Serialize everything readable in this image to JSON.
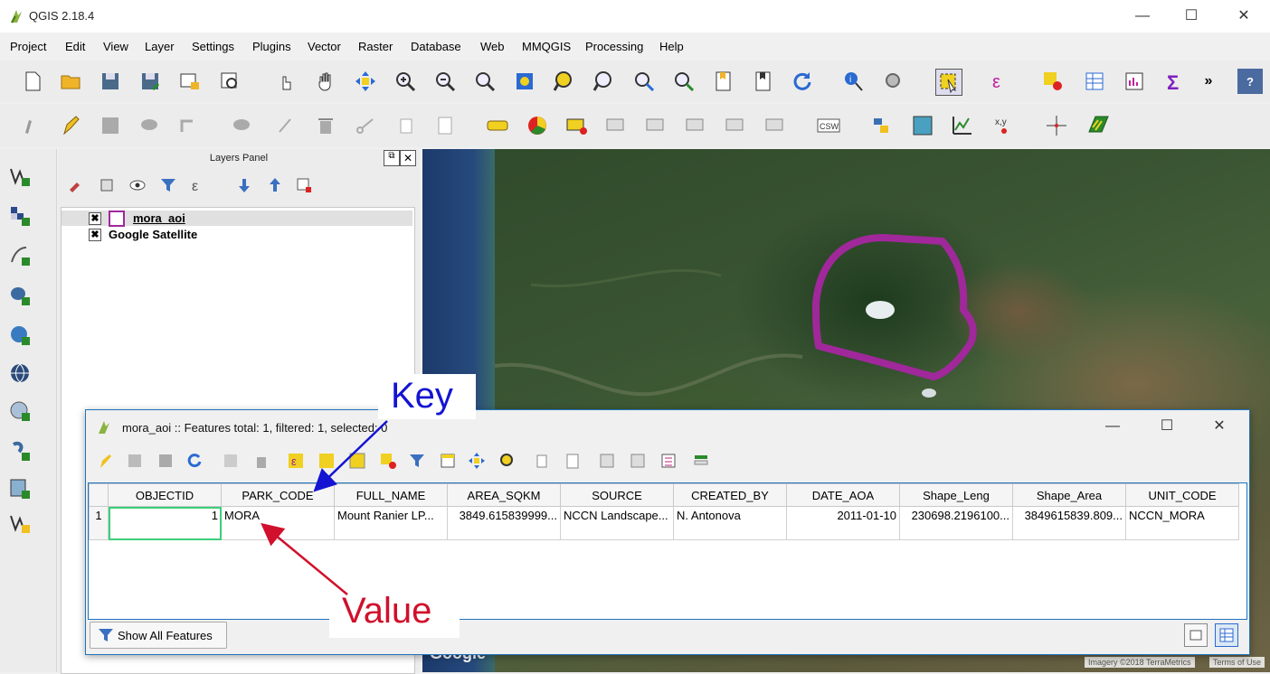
{
  "app": {
    "title": "QGIS 2.18.4"
  },
  "window_controls": {
    "minimize": "—",
    "maximize": "☐",
    "close": "✕"
  },
  "menu": [
    "Project",
    "Edit",
    "View",
    "Layer",
    "Settings",
    "Plugins",
    "Vector",
    "Raster",
    "Database",
    "Web",
    "MMQGIS",
    "Processing",
    "Help"
  ],
  "toolbar": {
    "overflow": "»",
    "help": "?"
  },
  "layers_panel": {
    "title": "Layers Panel",
    "layers": [
      {
        "name": "mora_aoi",
        "checked": "✖"
      },
      {
        "name": "Google Satellite",
        "checked": "✖"
      }
    ]
  },
  "map": {
    "google_label": "Google",
    "attribution": "Imagery ©2018 TerraMetrics",
    "terms": "Terms of Use",
    "aoi_color": "#a0289a"
  },
  "attribute_table": {
    "title": "mora_aoi :: Features total: 1, filtered: 1, selected: 0",
    "columns": [
      "OBJECTID",
      "PARK_CODE",
      "FULL_NAME",
      "AREA_SQKM",
      "SOURCE",
      "CREATED_BY",
      "DATE_AOA",
      "Shape_Leng",
      "Shape_Area",
      "UNIT_CODE"
    ],
    "rows": [
      {
        "row_number": "1",
        "cells": [
          "1",
          "MORA",
          "Mount Ranier LP...",
          "3849.615839999...",
          "NCCN Landscape...",
          "N. Antonova",
          "2011-01-10",
          "230698.2196100...",
          "3849615839.809...",
          "NCCN_MORA"
        ]
      }
    ],
    "show_all_label": "Show All Features"
  },
  "annotations": {
    "key_label": "Key",
    "value_label": "Value",
    "key_color": "#1414d2",
    "value_color": "#d0102c"
  }
}
